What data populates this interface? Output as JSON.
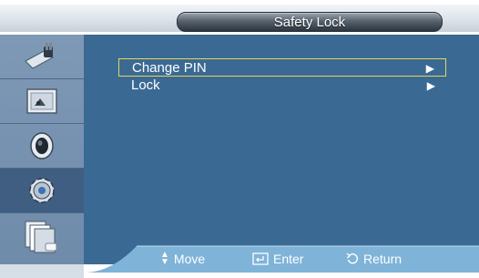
{
  "header": {
    "title": "Safety Lock"
  },
  "sidebar": {
    "items": [
      {
        "icon": "input-plug-icon"
      },
      {
        "icon": "picture-screen-icon"
      },
      {
        "icon": "speaker-sound-icon"
      },
      {
        "icon": "gear-setup-icon",
        "active": true
      },
      {
        "icon": "multi-window-icon"
      }
    ]
  },
  "menu": {
    "items": [
      {
        "label": "Change PIN",
        "arrow": "▶"
      },
      {
        "label": "Lock",
        "arrow": "▶"
      }
    ]
  },
  "footer": {
    "move": {
      "icon": "updown-icon",
      "label": "Move"
    },
    "enter": {
      "icon": "enter-icon",
      "label": "Enter"
    },
    "return": {
      "icon": "return-icon",
      "label": "Return"
    }
  },
  "colors": {
    "panel": "#3a6a94",
    "sidebar": "#7e99b6",
    "selection": "#e7d35a"
  }
}
